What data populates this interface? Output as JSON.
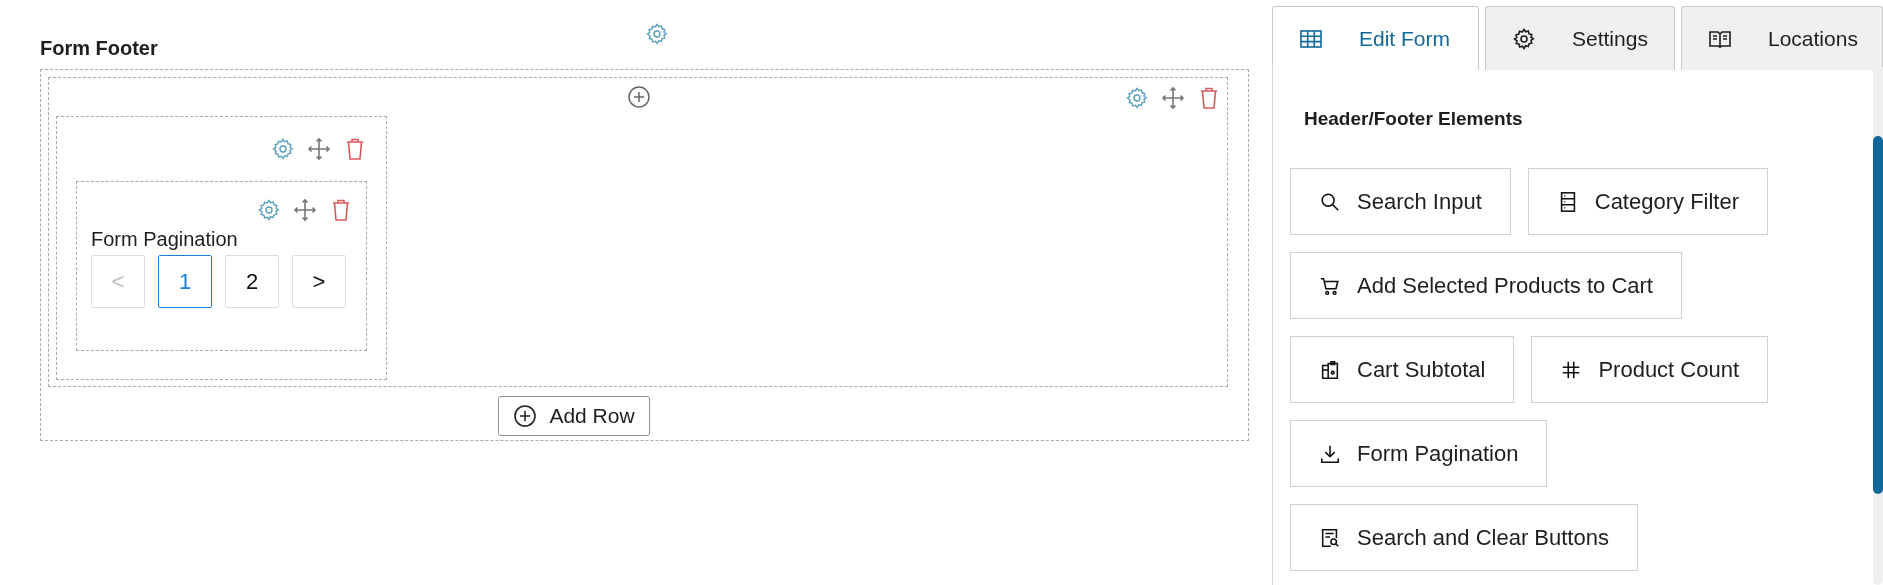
{
  "builder": {
    "title": "Form Footer",
    "add_row": "Add Row",
    "element": {
      "title": "Form Pagination",
      "pages": [
        {
          "label": "<",
          "disabled": true,
          "selected": false
        },
        {
          "label": "1",
          "disabled": false,
          "selected": true
        },
        {
          "label": "2",
          "disabled": false,
          "selected": false
        },
        {
          "label": ">",
          "disabled": false,
          "selected": false
        }
      ]
    }
  },
  "tabs": [
    {
      "label": "Edit Form",
      "selected": true
    },
    {
      "label": "Settings",
      "selected": false
    },
    {
      "label": "Locations",
      "selected": false
    }
  ],
  "panel": {
    "heading": "Header/Footer Elements",
    "elements": [
      {
        "label": "Search Input"
      },
      {
        "label": "Category Filter"
      },
      {
        "label": "Add Selected Products to Cart"
      },
      {
        "label": "Cart Subtotal"
      },
      {
        "label": "Product Count"
      },
      {
        "label": "Form Pagination"
      },
      {
        "label": "Search and Clear Buttons"
      }
    ]
  }
}
